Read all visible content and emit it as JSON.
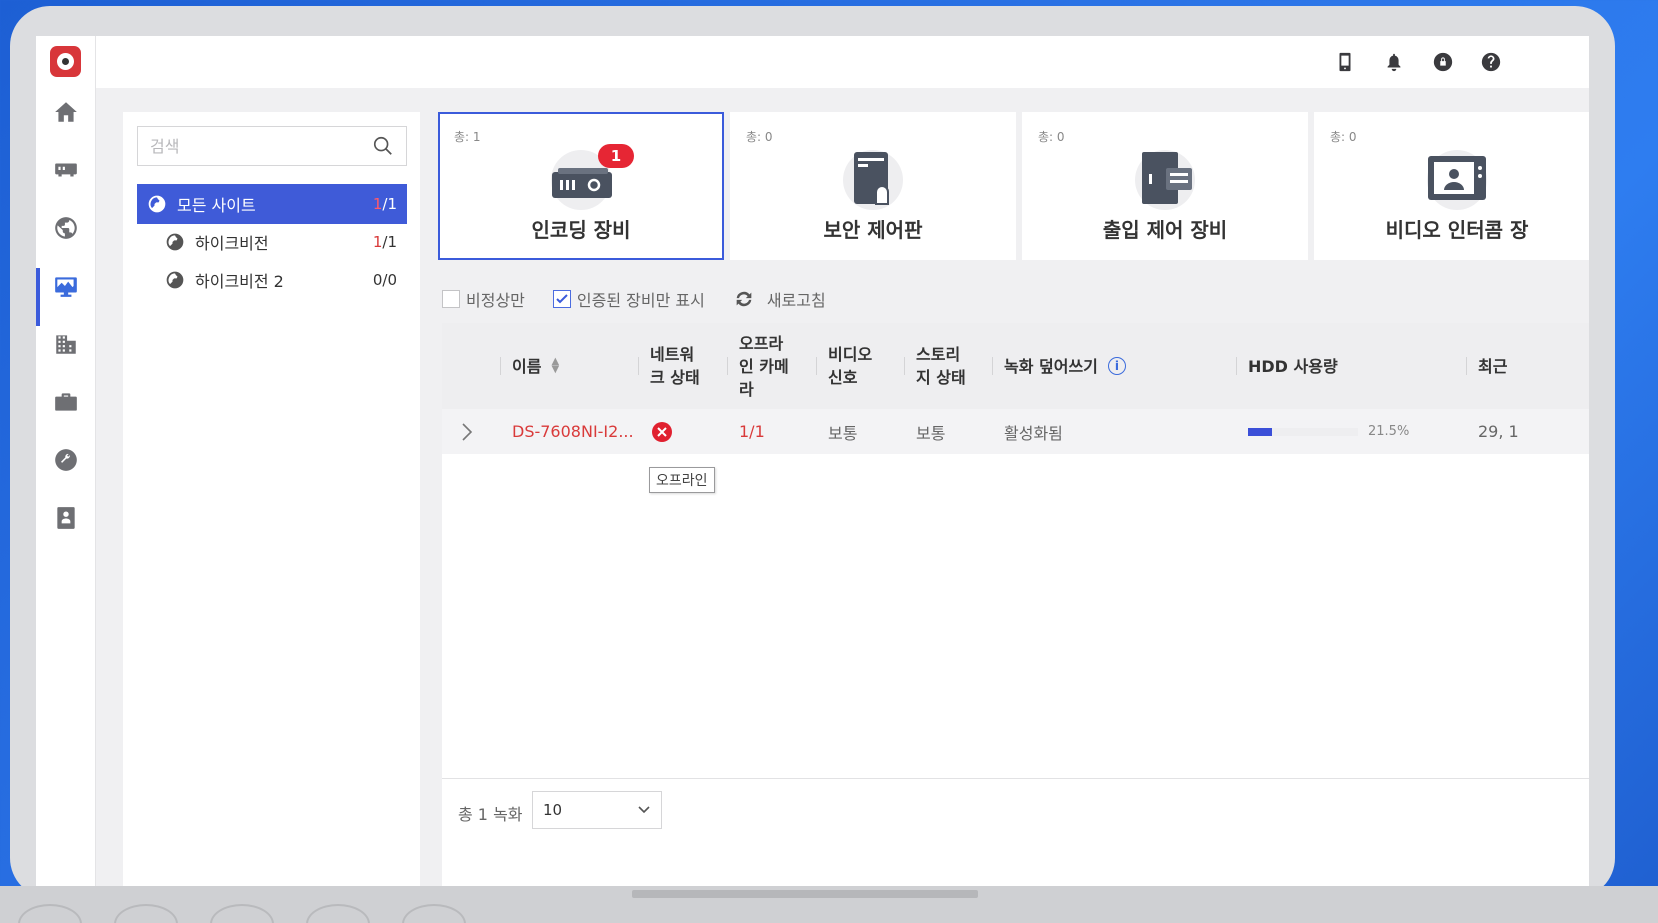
{
  "sidebar": {
    "items": [
      {
        "name": "home-icon"
      },
      {
        "name": "device-icon"
      },
      {
        "name": "globe-icon"
      },
      {
        "name": "monitor-icon"
      },
      {
        "name": "building-icon"
      },
      {
        "name": "briefcase-icon"
      },
      {
        "name": "wrench-icon"
      },
      {
        "name": "book-icon"
      }
    ]
  },
  "topbar": {
    "icons": [
      "mobile-icon",
      "bell-icon",
      "lock-icon",
      "help-icon"
    ]
  },
  "sites": {
    "search_placeholder": "검색",
    "list": [
      {
        "label": "모든 사이트",
        "count_red": "1",
        "count_rest": "/1"
      },
      {
        "label": "하이크비전",
        "count_red": "1",
        "count_rest": "/1"
      },
      {
        "label": "하이크비전 2",
        "count_red": "",
        "count_rest": "0/0"
      }
    ]
  },
  "device_types": [
    {
      "total": "총: 1",
      "label": "인코딩 장비",
      "badge": "1"
    },
    {
      "total": "총: 0",
      "label": "보안 제어판"
    },
    {
      "total": "총: 0",
      "label": "출입 제어 장비"
    },
    {
      "total": "총: 0",
      "label": "비디오 인터콤 장"
    }
  ],
  "filters": {
    "abnormal_only": "비정상만",
    "authorized_only": "인증된 장비만 표시",
    "refresh": "새로고침"
  },
  "table": {
    "headers": {
      "name": "이름",
      "network_status": [
        "네트워",
        "크 상태"
      ],
      "offline_camera": [
        "오프라",
        "인 카메",
        "라"
      ],
      "video_signal": [
        "비디오",
        "신호"
      ],
      "storage_status": [
        "스토리",
        "지 상태"
      ],
      "overwrite": "녹화 덮어쓰기",
      "hdd": "HDD 사용량",
      "recent": "최근"
    },
    "rows": [
      {
        "name": "DS-7608NI-I2...",
        "offline_camera": "1/1",
        "video_signal": "보통",
        "storage_status": "보통",
        "overwrite": "활성화됨",
        "hdd_percent": 21.5,
        "hdd_text": "21.5%",
        "recent": "29, 1"
      }
    ],
    "tooltip": "오프라인"
  },
  "footer": {
    "total_records": "총 1 녹화",
    "page_size": "10"
  },
  "colors": {
    "accent": "#3b5bdb",
    "error": "#e0202f",
    "badge": "#e62634"
  }
}
